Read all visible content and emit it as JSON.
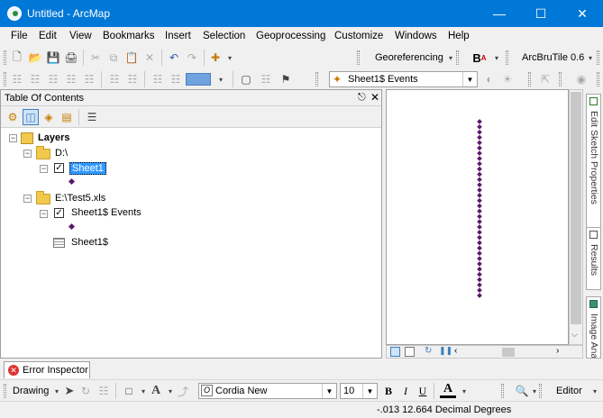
{
  "window": {
    "title": "Untitled - ArcMap"
  },
  "menu": [
    "File",
    "Edit",
    "View",
    "Bookmarks",
    "Insert",
    "Selection",
    "Geoprocessing",
    "Customize",
    "Windows",
    "Help"
  ],
  "toolbar": {
    "georeferencing_label": "Georeferencing",
    "arcbrutile_label": "ArcBruTile 0.6",
    "layer_combo_value": "Sheet1$ Events"
  },
  "toc": {
    "title": "Table Of Contents",
    "tree": {
      "root": "Layers",
      "group1": "D:\\",
      "layer1": "Sheet1",
      "group2": "E:\\Test5.xls",
      "layer2": "Sheet1$ Events",
      "table1": "Sheet1$"
    }
  },
  "dock_tabs": [
    "Edit Sketch Properties",
    "Results",
    "Image Analysis"
  ],
  "inspector": {
    "label": "Error Inspector"
  },
  "drawing": {
    "drawing_label": "Drawing",
    "font_name": "Cordia New",
    "font_size": "10",
    "bold": "B",
    "italic": "I",
    "underline": "U",
    "font_color_letter": "A",
    "editor_label": "Editor"
  },
  "status": {
    "coords": "-.013  12.664 Decimal Degrees"
  },
  "map": {
    "point_count": 34,
    "point_color": "#5a1a6a"
  }
}
